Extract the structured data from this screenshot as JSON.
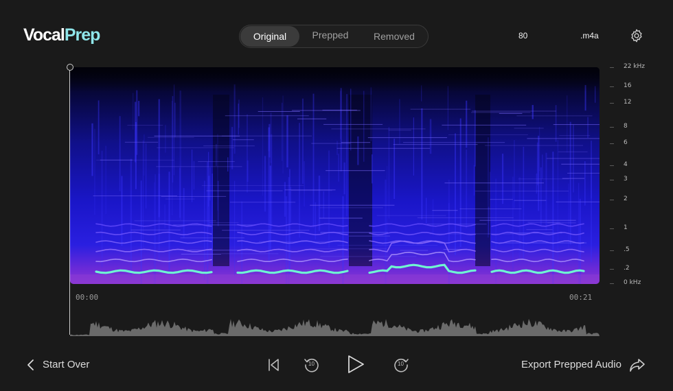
{
  "app": {
    "logo_main": "Vocal",
    "logo_accent": "Prep"
  },
  "header": {
    "tabs": [
      {
        "label": "Original",
        "active": true
      },
      {
        "label": "Prepped",
        "active": false
      },
      {
        "label": "Removed",
        "active": false
      }
    ],
    "value_1": "80",
    "format": ".m4a",
    "settings_icon": "gear-icon"
  },
  "spectrogram": {
    "freq_labels": [
      "22 kHz",
      "16",
      "12",
      "8",
      "6",
      "4",
      "3",
      "2",
      "1",
      ".5",
      ".2",
      "0 kHz"
    ],
    "time_start": "00:00",
    "time_end": "00:21",
    "playhead_fraction": 0.0
  },
  "footer": {
    "start_over": "Start Over",
    "export": "Export Prepped Audio",
    "skip_back_seconds": "10",
    "skip_forward_seconds": "10"
  },
  "colors": {
    "background": "#1a1a1a",
    "accent": "#8fe6ea",
    "spectro_low": "#1a14c8",
    "spectro_high": "#6ff5d2"
  }
}
